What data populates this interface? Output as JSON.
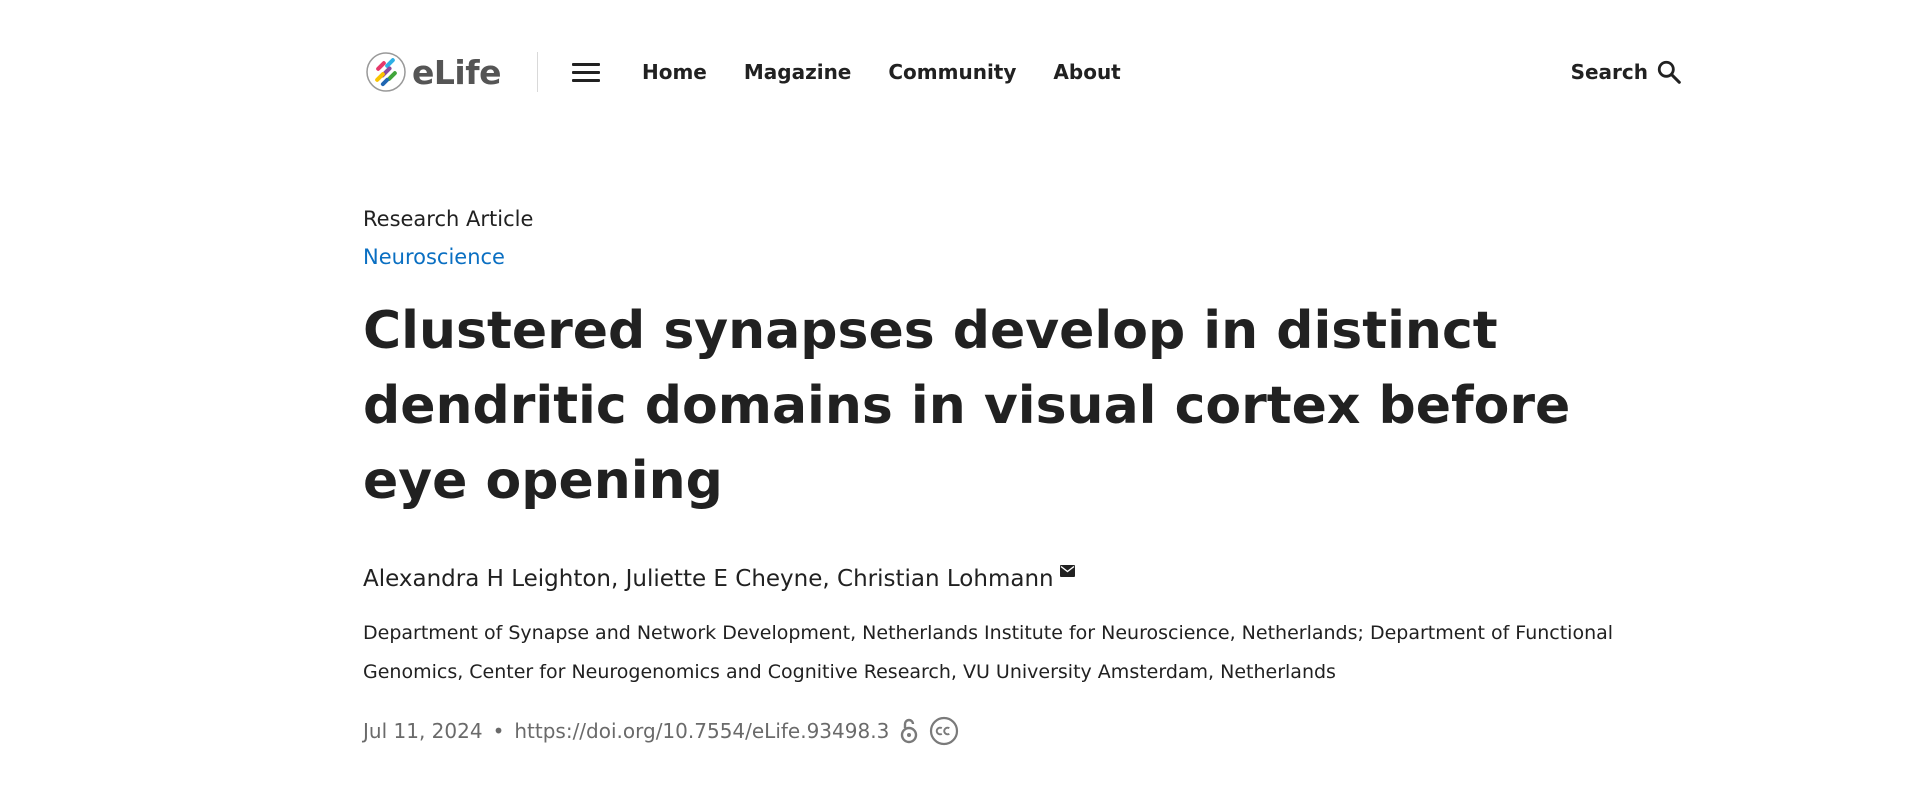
{
  "header": {
    "logo_text": "eLife",
    "nav": [
      "Home",
      "Magazine",
      "Community",
      "About"
    ],
    "search_label": "Search"
  },
  "article": {
    "type": "Research Article",
    "subject": "Neuroscience",
    "title": "Clustered synapses develop in distinct dendritic domains in visual cortex before eye opening",
    "authors": [
      "Alexandra H Leighton",
      "Juliette E Cheyne",
      "Christian Lohmann"
    ],
    "affiliations": "Department of Synapse and Network Development, Netherlands Institute for Neuroscience, Netherlands; Department of Functional Genomics, Center for Neurogenomics and Cognitive Research, VU University Amsterdam, Netherlands",
    "date": "Jul 11, 2024",
    "separator": "•",
    "doi": "https://doi.org/10.7554/eLife.93498.3"
  },
  "colors": {
    "subject_link": "#0a6fc2",
    "text": "#212121",
    "meta": "#6a6a6a"
  },
  "icons": {
    "menu": "hamburger-icon",
    "search": "search-icon",
    "mail": "mail-icon",
    "open_access": "open-access-icon",
    "license": "creative-commons-icon"
  }
}
